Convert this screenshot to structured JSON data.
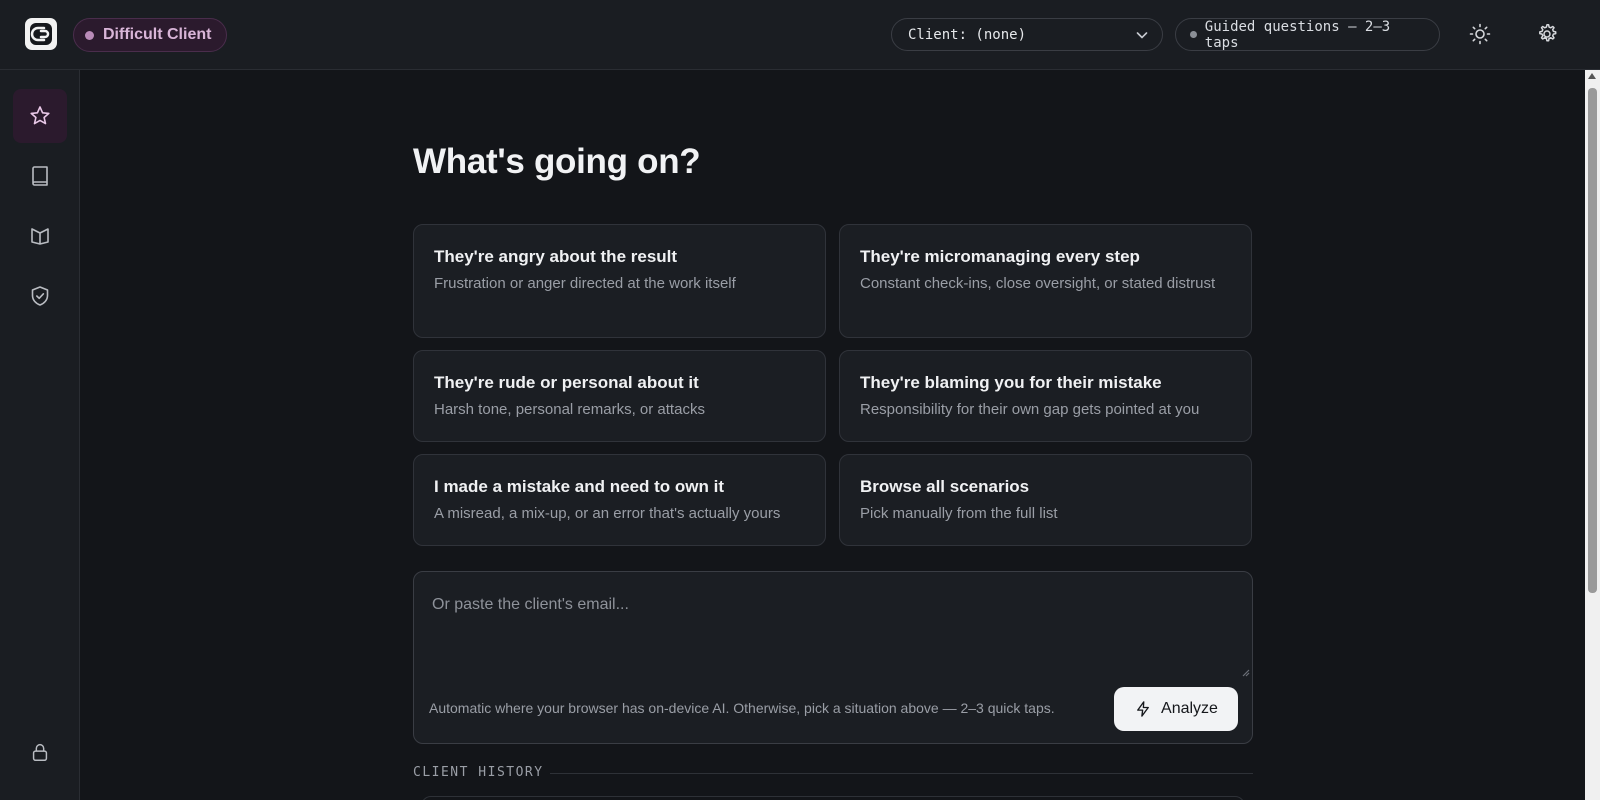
{
  "header": {
    "mode_label": "Difficult Client",
    "client_select_value": "Client: (none)",
    "guided_label": "Guided questions — 2–3 taps",
    "icons": [
      "logo-icon",
      "chevron-down-icon",
      "sun-icon",
      "gear-icon"
    ]
  },
  "sidebar": {
    "items": [
      {
        "icon": "star-icon",
        "active": true
      },
      {
        "icon": "book-icon",
        "active": false
      },
      {
        "icon": "open-book-icon",
        "active": false
      },
      {
        "icon": "shield-check-icon",
        "active": false
      }
    ],
    "bottom_icon": "lock-icon"
  },
  "main": {
    "heading": "What's going on?",
    "scenarios": [
      {
        "title": "They're angry about the result",
        "description": "Frustration or anger directed at the work itself"
      },
      {
        "title": "They're micromanaging every step",
        "description": "Constant check-ins, close oversight, or stated distrust"
      },
      {
        "title": "They're rude or personal about it",
        "description": "Harsh tone, personal remarks, or attacks"
      },
      {
        "title": "They're blaming you for their mistake",
        "description": "Responsibility for their own gap gets pointed at you"
      },
      {
        "title": "I made a mistake and need to own it",
        "description": "A misread, a mix-up, or an error that's actually yours"
      },
      {
        "title": "Browse all scenarios",
        "description": "Pick manually from the full list"
      }
    ],
    "email": {
      "placeholder": "Or paste the client's email...",
      "value": "",
      "hint": "Automatic where your browser has on-device AI. Otherwise, pick a situation above — 2–3 quick taps.",
      "analyze_label": "Analyze"
    },
    "history_label": "CLIENT HISTORY"
  },
  "colors": {
    "background": "#131519",
    "panel": "#1a1d22",
    "card": "#1b1e23",
    "accent": "#d9b5d8",
    "accent_bg": "#2b1a2d"
  }
}
